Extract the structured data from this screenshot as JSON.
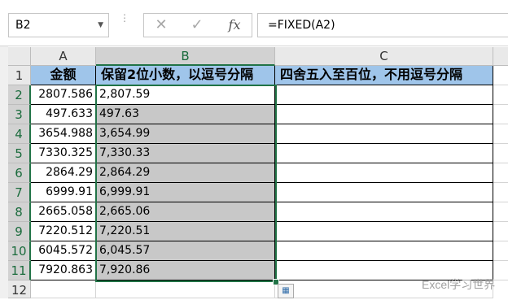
{
  "formula_bar": {
    "name_box": "B2",
    "name_box_dropdown_icon": "chevron-down-icon",
    "cancel_icon": "close-icon",
    "enter_icon": "check-icon",
    "function_icon": "fx-icon",
    "formula": "=FIXED(A2)"
  },
  "grid": {
    "columns": [
      "A",
      "B",
      "C"
    ],
    "selected_column": "B",
    "rows": [
      "1",
      "2",
      "3",
      "4",
      "5",
      "6",
      "7",
      "8",
      "9",
      "10",
      "11",
      "12"
    ],
    "selected_rows": [
      "2",
      "3",
      "4",
      "5",
      "6",
      "7",
      "8",
      "9",
      "10",
      "11"
    ],
    "header_row": {
      "a": "金额",
      "b": "保留2位小数，以逗号分隔",
      "c": "四舍五入至百位，不用逗号分隔"
    },
    "data_rows": [
      {
        "a": "2807.586",
        "b": "2,807.59",
        "c": ""
      },
      {
        "a": "497.633",
        "b": "497.63",
        "c": ""
      },
      {
        "a": "3654.988",
        "b": "3,654.99",
        "c": ""
      },
      {
        "a": "7330.325",
        "b": "7,330.33",
        "c": ""
      },
      {
        "a": "2864.29",
        "b": "2,864.29",
        "c": ""
      },
      {
        "a": "6999.91",
        "b": "6,999.91",
        "c": ""
      },
      {
        "a": "2665.058",
        "b": "2,665.06",
        "c": ""
      },
      {
        "a": "7220.512",
        "b": "7,220.51",
        "c": ""
      },
      {
        "a": "6045.572",
        "b": "6,045.57",
        "c": ""
      },
      {
        "a": "7920.863",
        "b": "7,920.86",
        "c": ""
      }
    ]
  },
  "quick_analysis_icon": "quick-analysis-icon",
  "watermark": "Excel学习世界",
  "colors": {
    "header_fill": "#9fc5ea",
    "selection_fill": "#c8c8c8",
    "selection_border": "#217346"
  }
}
